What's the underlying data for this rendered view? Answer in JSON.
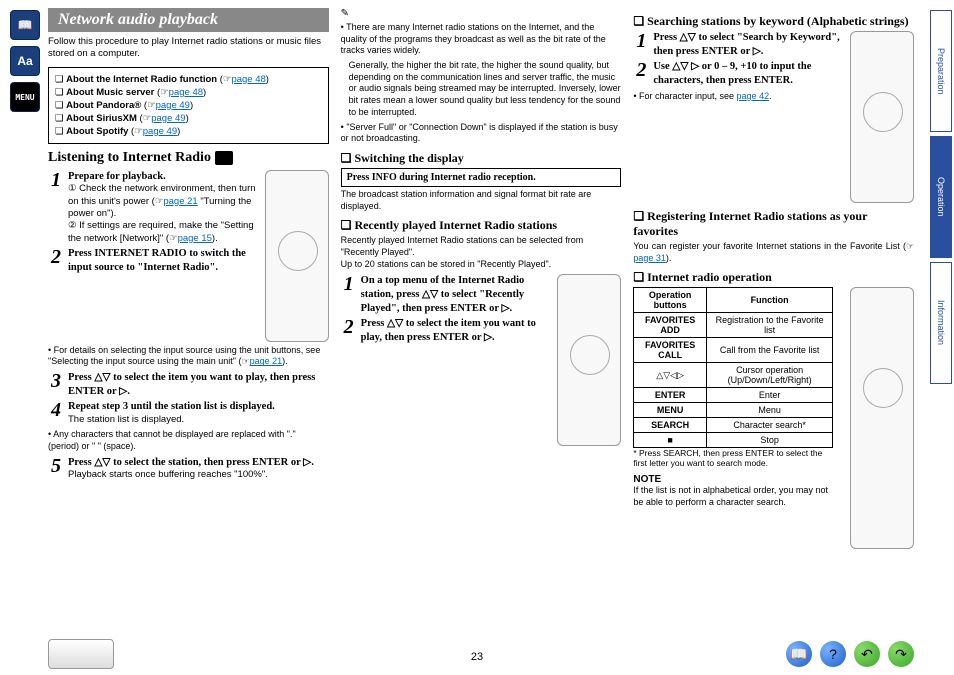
{
  "title": "Network audio playback",
  "intro": "Follow this procedure to play Internet radio stations or music files stored on a computer.",
  "links": {
    "l1": "About the Internet Radio function",
    "l1p": "page 48",
    "l2": "About Music server",
    "l2p": "page 48",
    "l3": "About Pandora®",
    "l3p": "page 49",
    "l4": "About SiriusXM",
    "l4p": "page 49",
    "l5": "About Spotify",
    "l5p": "page 49"
  },
  "listening_heading": "Listening to Internet Radio",
  "s1": {
    "t": "Prepare for playback.",
    "a": "① Check the network environment, then turn on this unit's power (☞",
    "ap": "page 21",
    "a2": " \"Turning the power on\").",
    "b": "② If settings are required, make the \"Setting the network [Network]\" (☞",
    "bp": "page 15",
    "b2": ")."
  },
  "s2": {
    "t": "Press INTERNET RADIO to switch the input source to \"Internet Radio\"."
  },
  "note1a": "For details on selecting the input source using the unit buttons, see \"Selecting the input source using the main unit\" (☞",
  "note1p": "page 21",
  "note1b": ").",
  "s3": {
    "t": "Press △▽ to select the item you want to play, then press ENTER or ▷."
  },
  "s4": {
    "t": "Repeat step 3 until the station list is displayed.",
    "d": "The station list is displayed."
  },
  "note2": "Any characters that cannot be displayed are replaced with \".\" (period) or \" \" (space).",
  "s5": {
    "t": "Press △▽ to select the station, then press ENTER or ▷.",
    "d": "Playback starts once buffering reaches \"100%\"."
  },
  "col2": {
    "p1": "There are many Internet radio stations on the Internet, and the quality of the programs they broadcast as well as the bit rate of the tracks varies widely.",
    "p2": "Generally, the higher the bit rate, the higher the sound quality, but depending on the communication lines and server traffic, the music or audio signals being streamed may be interrupted. Inversely, lower bit rates mean a lower sound quality but less tendency for the sound to be interrupted.",
    "p3": "\"Server Full\" or \"Connection Down\" is displayed if the station is busy or not broadcasting.",
    "switch_h": "Switching the display",
    "switch_box": "Press INFO during Internet radio reception.",
    "switch_d": "The broadcast station information and signal format bit rate are displayed.",
    "recent_h": "Recently played Internet Radio stations",
    "recent_d1": "Recently played Internet Radio stations can be selected from \"Recently Played\".",
    "recent_d2": "Up to 20 stations can be stored in \"Recently Played\".",
    "r1": "On a top menu of the Internet Radio station, press △▽ to select \"Recently Played\", then press ENTER or ▷.",
    "r2": "Press △▽ to select the item you want to play, then press ENTER or ▷."
  },
  "col3": {
    "search_h": "Searching stations by keyword (Alphabetic strings)",
    "k1": "Press △▽ to select \"Search by Keyword\", then press ENTER or ▷.",
    "k2": "Use △▽ ▷ or 0 – 9, +10 to input the characters, then press ENTER.",
    "knote_a": "For character input, see ",
    "knote_p": "page 42",
    "knote_b": ".",
    "reg_h": "Registering Internet Radio stations as your favorites",
    "reg_d_a": "You can register your favorite Internet stations in the Favorite List (☞",
    "reg_d_p": "page 31",
    "reg_d_b": ").",
    "op_h": "Internet radio operation",
    "table": {
      "h1": "Operation buttons",
      "h2": "Function",
      "r1a": "FAVORITES ADD",
      "r1b": "Registration to the Favorite list",
      "r2a": "FAVORITES CALL",
      "r2b": "Call from the Favorite list",
      "r3a": "△▽◁▷",
      "r3b": "Cursor operation (Up/Down/Left/Right)",
      "r4a": "ENTER",
      "r4b": "Enter",
      "r5a": "MENU",
      "r5b": "Menu",
      "r6a": "SEARCH",
      "r6b": "Character search*",
      "r7a": "■",
      "r7b": "Stop"
    },
    "star": "* Press SEARCH, then press ENTER to select the first letter you want to search mode.",
    "warn": "If the list is not in alphabetical order, you may not be able to perform a character search."
  },
  "tabs": {
    "t1": "Preparation",
    "t2": "Operation",
    "t3": "Information"
  },
  "page_number": "23"
}
